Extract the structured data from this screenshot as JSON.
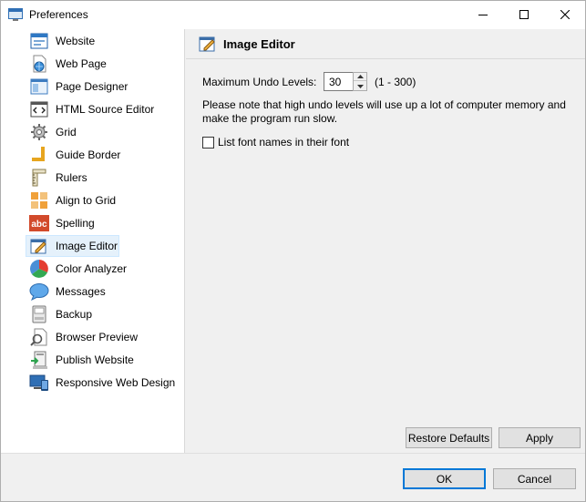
{
  "window": {
    "title": "Preferences",
    "icon": "app-window-icon",
    "controls": [
      "minimize-icon",
      "maximize-icon",
      "close-icon"
    ]
  },
  "sidebar": {
    "items": [
      {
        "label": "Website",
        "icon": "website-icon"
      },
      {
        "label": "Web Page",
        "icon": "web-page-icon"
      },
      {
        "label": "Page Designer",
        "icon": "page-designer-icon"
      },
      {
        "label": "HTML Source Editor",
        "icon": "html-source-icon"
      },
      {
        "label": "Grid",
        "icon": "grid-gear-icon"
      },
      {
        "label": "Guide Border",
        "icon": "guide-border-icon"
      },
      {
        "label": "Rulers",
        "icon": "rulers-icon"
      },
      {
        "label": "Align to Grid",
        "icon": "align-grid-icon"
      },
      {
        "label": "Spelling",
        "icon": "spelling-abc-icon"
      },
      {
        "label": "Image Editor",
        "icon": "image-editor-icon",
        "selected": true
      },
      {
        "label": "Color Analyzer",
        "icon": "color-analyzer-icon"
      },
      {
        "label": "Messages",
        "icon": "messages-icon"
      },
      {
        "label": "Backup",
        "icon": "backup-icon"
      },
      {
        "label": "Browser Preview",
        "icon": "browser-preview-icon"
      },
      {
        "label": "Publish Website",
        "icon": "publish-icon"
      },
      {
        "label": "Responsive Web Design",
        "icon": "responsive-design-icon"
      }
    ],
    "spelling_icon_text": "abc"
  },
  "panel": {
    "title": "Image Editor",
    "undo_label": "Maximum Undo Levels:",
    "undo_value": "30",
    "undo_range": "(1 - 300)",
    "note": "Please note that high undo levels will use up a lot of computer memory and make the program run slow.",
    "checkbox_label": "List font names in their font",
    "checkbox_checked": false,
    "restore_label": "Restore Defaults",
    "apply_label": "Apply"
  },
  "footer": {
    "ok_label": "OK",
    "cancel_label": "Cancel"
  }
}
